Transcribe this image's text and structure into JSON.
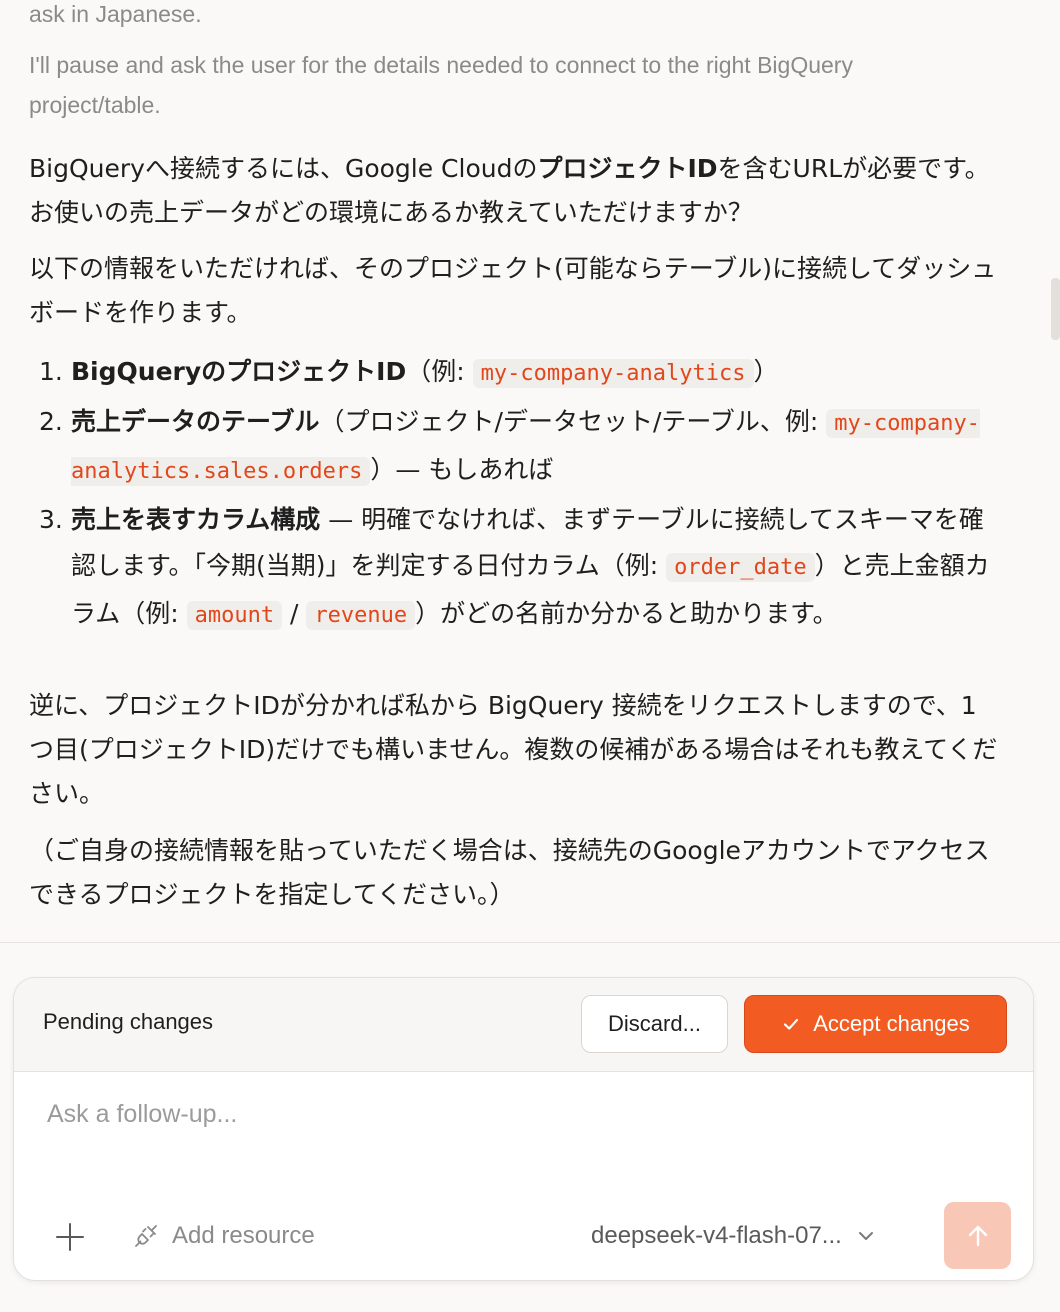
{
  "thinking": {
    "line_top": "ask in Japanese.",
    "line_2": "I'll pause and ask the user for the details needed to connect to the right BigQuery project/table."
  },
  "answer": {
    "p1_a": "BigQueryへ接続するには、Google Cloudの",
    "p1_bold": "プロジェクトID",
    "p1_b": "を含むURLが必要です。お使いの売上データがどの環境にあるか教えていただけますか？",
    "p2": "以下の情報をいただければ、そのプロジェクト(可能ならテーブル)に接続してダッシュボードを作ります。",
    "items": [
      {
        "num": "1.",
        "bold": "BigQueryのプロジェクトID",
        "a": "（例: ",
        "code1": "my-company-analytics",
        "b": "）"
      },
      {
        "num": "2.",
        "bold": "売上データのテーブル",
        "a": "（プロジェクト/データセット/テーブル、例: ",
        "code1": "my-company-analytics.sales.orders",
        "b": "）— もしあれば"
      },
      {
        "num": "3.",
        "bold": "売上を表すカラム構成",
        "a": " — 明確でなければ、まずテーブルに接続してスキーマを確認します。「今期(当期)」を判定する日付カラム（例: ",
        "code1": "order_date",
        "b": "）と売上金額カラム（例: ",
        "code2": "amount",
        "c": " / ",
        "code3": "revenue",
        "d": "）がどの名前か分かると助かります。"
      }
    ],
    "p3": "逆に、プロジェクトIDが分かれば私から BigQuery 接続をリクエストしますので、1つ目(プロジェクトID)だけでも構いません。複数の候補がある場合はそれも教えてください。",
    "p4": "（ご自身の接続情報を貼っていただく場合は、接続先のGoogleアカウントでアクセスできるプロジェクトを指定してください。）"
  },
  "composer": {
    "pending_label": "Pending changes",
    "discard_label": "Discard...",
    "accept_label": "Accept changes",
    "input_placeholder": "Ask a follow-up...",
    "add_resource_label": "Add resource",
    "model_label": "deepseek-v4-flash-07...",
    "accent_color": "#f25c22"
  },
  "icons": {
    "accept": "check-icon",
    "plus": "plus-icon",
    "resource": "plug-icon",
    "model": "chevron-down-icon",
    "send": "arrow-up-icon"
  }
}
